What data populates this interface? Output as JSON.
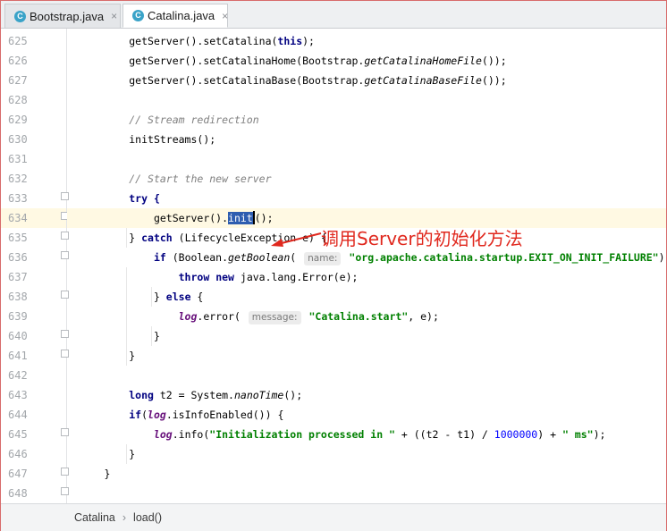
{
  "tabs": [
    {
      "label": "Bootstrap.java",
      "icon": "java-class-icon",
      "icon_letter": "C",
      "active": false
    },
    {
      "label": "Catalina.java",
      "icon": "java-class-icon",
      "icon_letter": "C",
      "active": true
    }
  ],
  "tab_close_glyph": "×",
  "line_numbers": [
    "625",
    "626",
    "627",
    "628",
    "629",
    "630",
    "631",
    "632",
    "633",
    "634",
    "635",
    "636",
    "637",
    "638",
    "639",
    "640",
    "641",
    "642",
    "643",
    "644",
    "645",
    "646",
    "647",
    "648"
  ],
  "code": {
    "l625": "getServer().setCatalina(this);",
    "l626": "getServer().setCatalinaHome(Bootstrap.getCatalinaHomeFile());",
    "l627": "getServer().setCatalinaBase(Bootstrap.getCatalinaBaseFile());",
    "l629": "// Stream redirection",
    "l630": "initStreams();",
    "l632": "// Start the new server",
    "l633": "try {",
    "l634": "getServer().init();",
    "l635": "} catch (LifecycleException e) {",
    "l636": "if (Boolean.getBoolean( name: \"org.apache.catalina.startup.EXIT_ON_INIT_FAILURE\"))",
    "l637": "throw new java.lang.Error(e);",
    "l638": "} else {",
    "l639": "log.error( message: \"Catalina.start\", e);",
    "l640": "}",
    "l641": "}",
    "l643": "long t2 = System.nanoTime();",
    "l644": "if(log.isInfoEnabled()) {",
    "l645": "log.info(\"Initialization processed in \" + ((t2 - t1) / 1000000) + \" ms\");",
    "l646": "}",
    "l647": "}"
  },
  "param_hints": {
    "name": "name:",
    "message": "message:"
  },
  "annotation": "调用Server的初始化方法",
  "breadcrumb": [
    "Catalina",
    "load()"
  ],
  "breadcrumb_sep": "›",
  "colors": {
    "keyword": "#000080",
    "string": "#008000",
    "comment": "#808080",
    "number": "#0000ff",
    "annotation": "#e0281e",
    "selection": "#2e5db0",
    "current_line": "#fff9e3"
  }
}
